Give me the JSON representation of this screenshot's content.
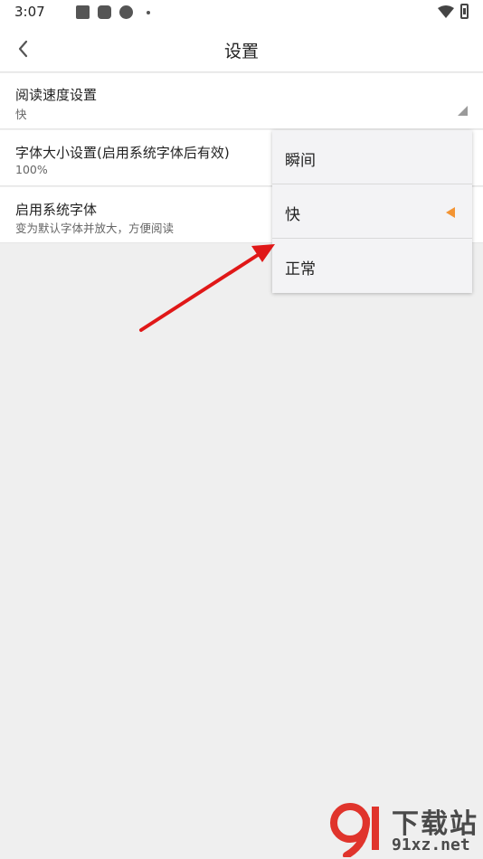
{
  "status_bar": {
    "time": "3:07",
    "dot": "•"
  },
  "app_bar": {
    "title": "设置",
    "back_icon": "chevron-left-icon"
  },
  "settings": [
    {
      "title": "阅读速度设置",
      "value": "快"
    },
    {
      "title": "字体大小设置(启用系统字体后有效)",
      "value": "100%"
    },
    {
      "title": "启用系统字体",
      "value": "变为默认字体并放大，方便阅读"
    }
  ],
  "popup": {
    "options": [
      "瞬间",
      "快",
      "正常"
    ],
    "selected": "快",
    "marker_color": "#f39433"
  },
  "annotation": {
    "arrow_color": "#e01818"
  },
  "watermark": {
    "title": "下载站",
    "url": "91xz.net",
    "logo_color": "#e0342c"
  }
}
